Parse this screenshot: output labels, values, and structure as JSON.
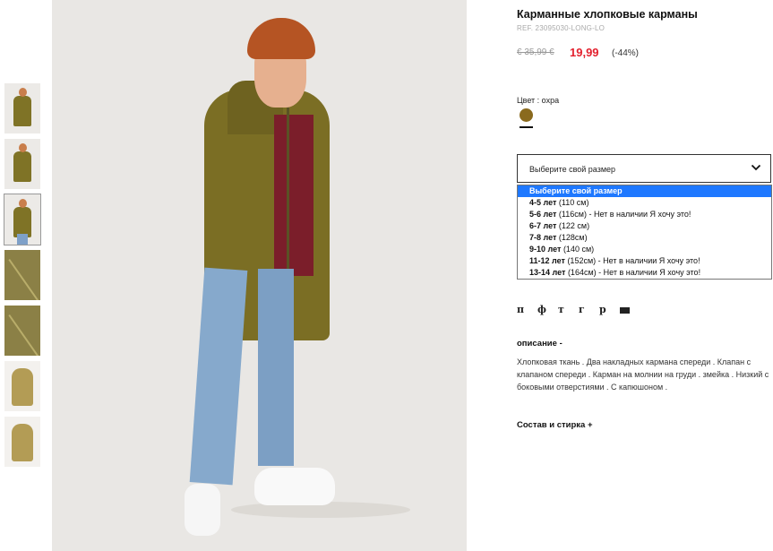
{
  "product": {
    "title": "Карманные хлопковые карманы",
    "ref": "REF. 23095030-LONG-LO",
    "old_price": "€ 35,99 €",
    "new_price": "19,99",
    "discount": "(-44%)"
  },
  "color": {
    "label": "Цвет : охра",
    "swatch": "#8a6a1e"
  },
  "size_select": {
    "placeholder": "Выберите свой размер",
    "options": [
      {
        "label": "Выберите свой размер",
        "size": "",
        "note": "",
        "selected": true
      },
      {
        "label": "4-5 лет",
        "size": "(110 см)",
        "note": "",
        "selected": false
      },
      {
        "label": "5-6 лет",
        "size": "(116см)",
        "note": " - Нет в наличии Я хочу это!",
        "selected": false
      },
      {
        "label": "6-7 лет",
        "size": "(122 см)",
        "note": "",
        "selected": false
      },
      {
        "label": "7-8 лет",
        "size": "(128см)",
        "note": "",
        "selected": false
      },
      {
        "label": "9-10 лет",
        "size": "(140 см)",
        "note": "",
        "selected": false
      },
      {
        "label": "11-12 лет",
        "size": "(152см)",
        "note": " - Нет в наличии Я хочу это!",
        "selected": false
      },
      {
        "label": "13-14 лет",
        "size": "(164см)",
        "note": " - Нет в наличии Я хочу это!",
        "selected": false
      }
    ]
  },
  "social": {
    "icons": [
      "п",
      "ф",
      "т",
      "г",
      "р"
    ],
    "mail_icon": "mail-icon"
  },
  "description": {
    "heading": "описание -",
    "text": "Хлопковая ткань . Два накладных кармана спереди . Клапан с клапаном спереди . Карман на молнии на груди . змейка . Низкий с боковыми отверстиями . С капюшоном ."
  },
  "composition": {
    "heading": "Состав и стирка +"
  },
  "gallery": {
    "thumbnails": [
      "thumb-front",
      "thumb-side",
      "thumb-full",
      "thumb-detail-1",
      "thumb-detail-2",
      "thumb-flat-front",
      "thumb-flat-back"
    ]
  }
}
